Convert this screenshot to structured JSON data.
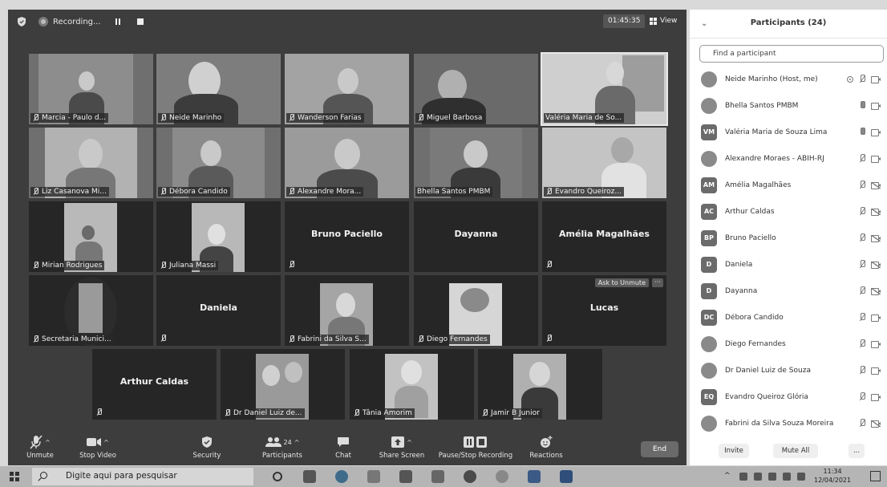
{
  "topbar": {
    "recording_label": "Recording...",
    "timer": "01:45:35",
    "view_label": "View"
  },
  "tiles": [
    {
      "label": "Marcia - Paulo d...",
      "type": "video"
    },
    {
      "label": "Neide Marinho",
      "type": "video"
    },
    {
      "label": "Wanderson Farias",
      "type": "video"
    },
    {
      "label": "Miguel Barbosa",
      "type": "video"
    },
    {
      "label": "Valéria Maria de So...",
      "type": "video",
      "active_speaker": true
    },
    {
      "label": "Liz Casanova Mi...",
      "type": "video"
    },
    {
      "label": "Débora Candido",
      "type": "video"
    },
    {
      "label": "Alexandre Mora...",
      "type": "video"
    },
    {
      "label": "Bhella Santos PMBM",
      "type": "video"
    },
    {
      "label": "Evandro Queiroz...",
      "type": "video"
    },
    {
      "label": "Mirian Rodrigues",
      "type": "video"
    },
    {
      "label": "Juliana Massi",
      "type": "video"
    },
    {
      "name": "Bruno Paciello",
      "type": "name"
    },
    {
      "name": "Dayanna",
      "type": "name"
    },
    {
      "name": "Amélia Magalhães",
      "type": "name"
    },
    {
      "label": "Secretaria Munici...",
      "type": "video"
    },
    {
      "name": "Daniela",
      "type": "name"
    },
    {
      "label": "Fabrini da Silva S...",
      "type": "video"
    },
    {
      "label": "Diego Fernandes",
      "type": "video"
    },
    {
      "name": "Lucas",
      "type": "name",
      "ask_label": "Ask to Unmute",
      "more_label": "···"
    },
    {
      "name": "Arthur Caldas",
      "type": "name"
    },
    {
      "label": "Dr Daniel Luiz de...",
      "type": "video"
    },
    {
      "label": "Tânia Amorim",
      "type": "video"
    },
    {
      "label": "Jamir B Junior",
      "type": "video"
    }
  ],
  "toolbar": {
    "unmute": "Unmute",
    "stop_video": "Stop Video",
    "security": "Security",
    "participants": "Participants",
    "participants_count": "24",
    "chat": "Chat",
    "share_screen": "Share Screen",
    "pause_stop_recording": "Pause/Stop Recording",
    "reactions": "Reactions",
    "end": "End"
  },
  "panel": {
    "title": "Participants (24)",
    "search_placeholder": "Find a participant",
    "participants": [
      {
        "name": "Neide Marinho (Host, me)",
        "avatar": "",
        "mic": "muted",
        "cam": "on",
        "recording": true
      },
      {
        "name": "Bhella Santos PMBM",
        "avatar": "",
        "mic": "live",
        "cam": "on"
      },
      {
        "name": "Valéria Maria de Souza Lima",
        "avatar": "VM",
        "mic": "live",
        "cam": "on"
      },
      {
        "name": "Alexandre Moraes - ABIH-RJ",
        "avatar": "",
        "mic": "muted",
        "cam": "on"
      },
      {
        "name": "Amélia Magalhães",
        "avatar": "AM",
        "mic": "muted",
        "cam": "off"
      },
      {
        "name": "Arthur Caldas",
        "avatar": "AC",
        "mic": "muted",
        "cam": "off"
      },
      {
        "name": "Bruno Paciello",
        "avatar": "BP",
        "mic": "muted",
        "cam": "off"
      },
      {
        "name": "Daniela",
        "avatar": "D",
        "mic": "muted",
        "cam": "off"
      },
      {
        "name": "Dayanna",
        "avatar": "D",
        "mic": "muted",
        "cam": "off"
      },
      {
        "name": "Débora Candido",
        "avatar": "DC",
        "mic": "muted",
        "cam": "on"
      },
      {
        "name": "Diego Fernandes",
        "avatar": "",
        "mic": "muted",
        "cam": "on"
      },
      {
        "name": "Dr Daniel Luiz de Souza",
        "avatar": "",
        "mic": "muted",
        "cam": "on"
      },
      {
        "name": "Evandro Queiroz Glória",
        "avatar": "EQ",
        "mic": "muted",
        "cam": "on"
      },
      {
        "name": "Fabrini da Silva Souza Moreira",
        "avatar": "",
        "mic": "muted",
        "cam": "off"
      }
    ],
    "invite": "Invite",
    "mute_all": "Mute All",
    "more": "..."
  },
  "taskbar": {
    "search_text": "Digite aqui para pesquisar",
    "time": "11:34",
    "date": "12/04/2021"
  }
}
